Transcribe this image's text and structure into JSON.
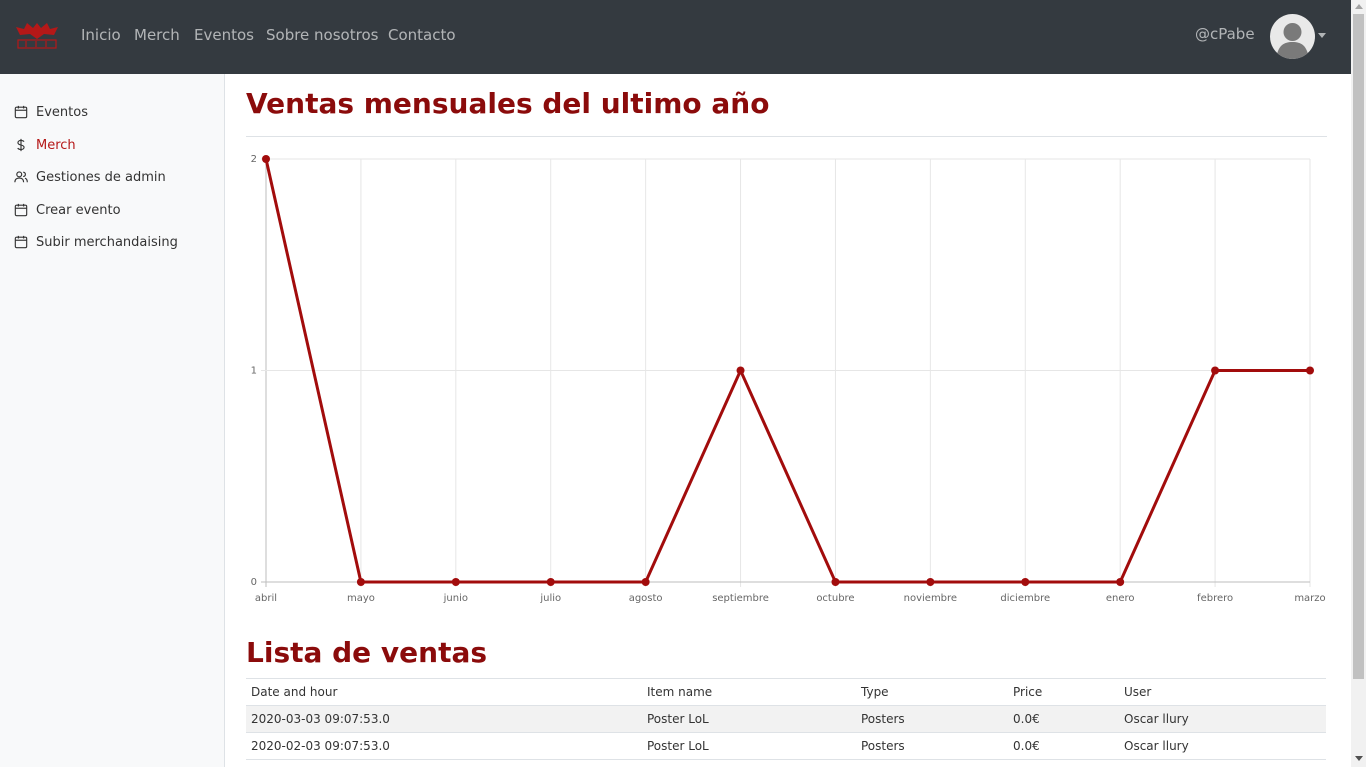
{
  "navbar": {
    "links": [
      "Inicio",
      "Merch",
      "Eventos",
      "Sobre nosotros",
      "Contacto"
    ],
    "username": "@cPabe",
    "logo_icon": "bat-logo-icon",
    "avatar_icon": "user-avatar-icon"
  },
  "sidebar": {
    "items": [
      {
        "label": "Eventos",
        "icon": "calendar-icon",
        "active": false
      },
      {
        "label": "Merch",
        "icon": "dollar-icon",
        "active": true
      },
      {
        "label": "Gestiones de admin",
        "icon": "users-icon",
        "active": false
      },
      {
        "label": "Crear evento",
        "icon": "calendar-icon",
        "active": false
      },
      {
        "label": "Subir merchandaising",
        "icon": "calendar-icon",
        "active": false
      }
    ]
  },
  "main": {
    "chart_title": "Ventas mensuales del ultimo año",
    "list_title": "Lista de ventas"
  },
  "chart_data": {
    "type": "line",
    "title": "",
    "xlabel": "",
    "ylabel": "",
    "categories": [
      "abril",
      "mayo",
      "junio",
      "julio",
      "agosto",
      "septiembre",
      "octubre",
      "noviembre",
      "diciembre",
      "enero",
      "febrero",
      "marzo"
    ],
    "series": [
      {
        "values": [
          2,
          0,
          0,
          0,
          0,
          1,
          0,
          0,
          0,
          0,
          1,
          1
        ]
      }
    ],
    "yticks": [
      "0",
      "1",
      "2"
    ],
    "ylim": [
      0,
      2
    ],
    "grid": true,
    "legend": "none",
    "color": "#a20c0c"
  },
  "table": {
    "headers": [
      "Date and hour",
      "Item name",
      "Type",
      "Price",
      "User"
    ],
    "rows": [
      [
        "2020-03-03 09:07:53.0",
        "Poster LoL",
        "Posters",
        "0.0€",
        "Oscar llury"
      ],
      [
        "2020-02-03 09:07:53.0",
        "Poster LoL",
        "Posters",
        "0.0€",
        "Oscar llury"
      ]
    ]
  },
  "colors": {
    "accent": "#8b0b0b",
    "navbar_bg": "#343a40",
    "sidebar_bg": "#f8f9fa"
  }
}
